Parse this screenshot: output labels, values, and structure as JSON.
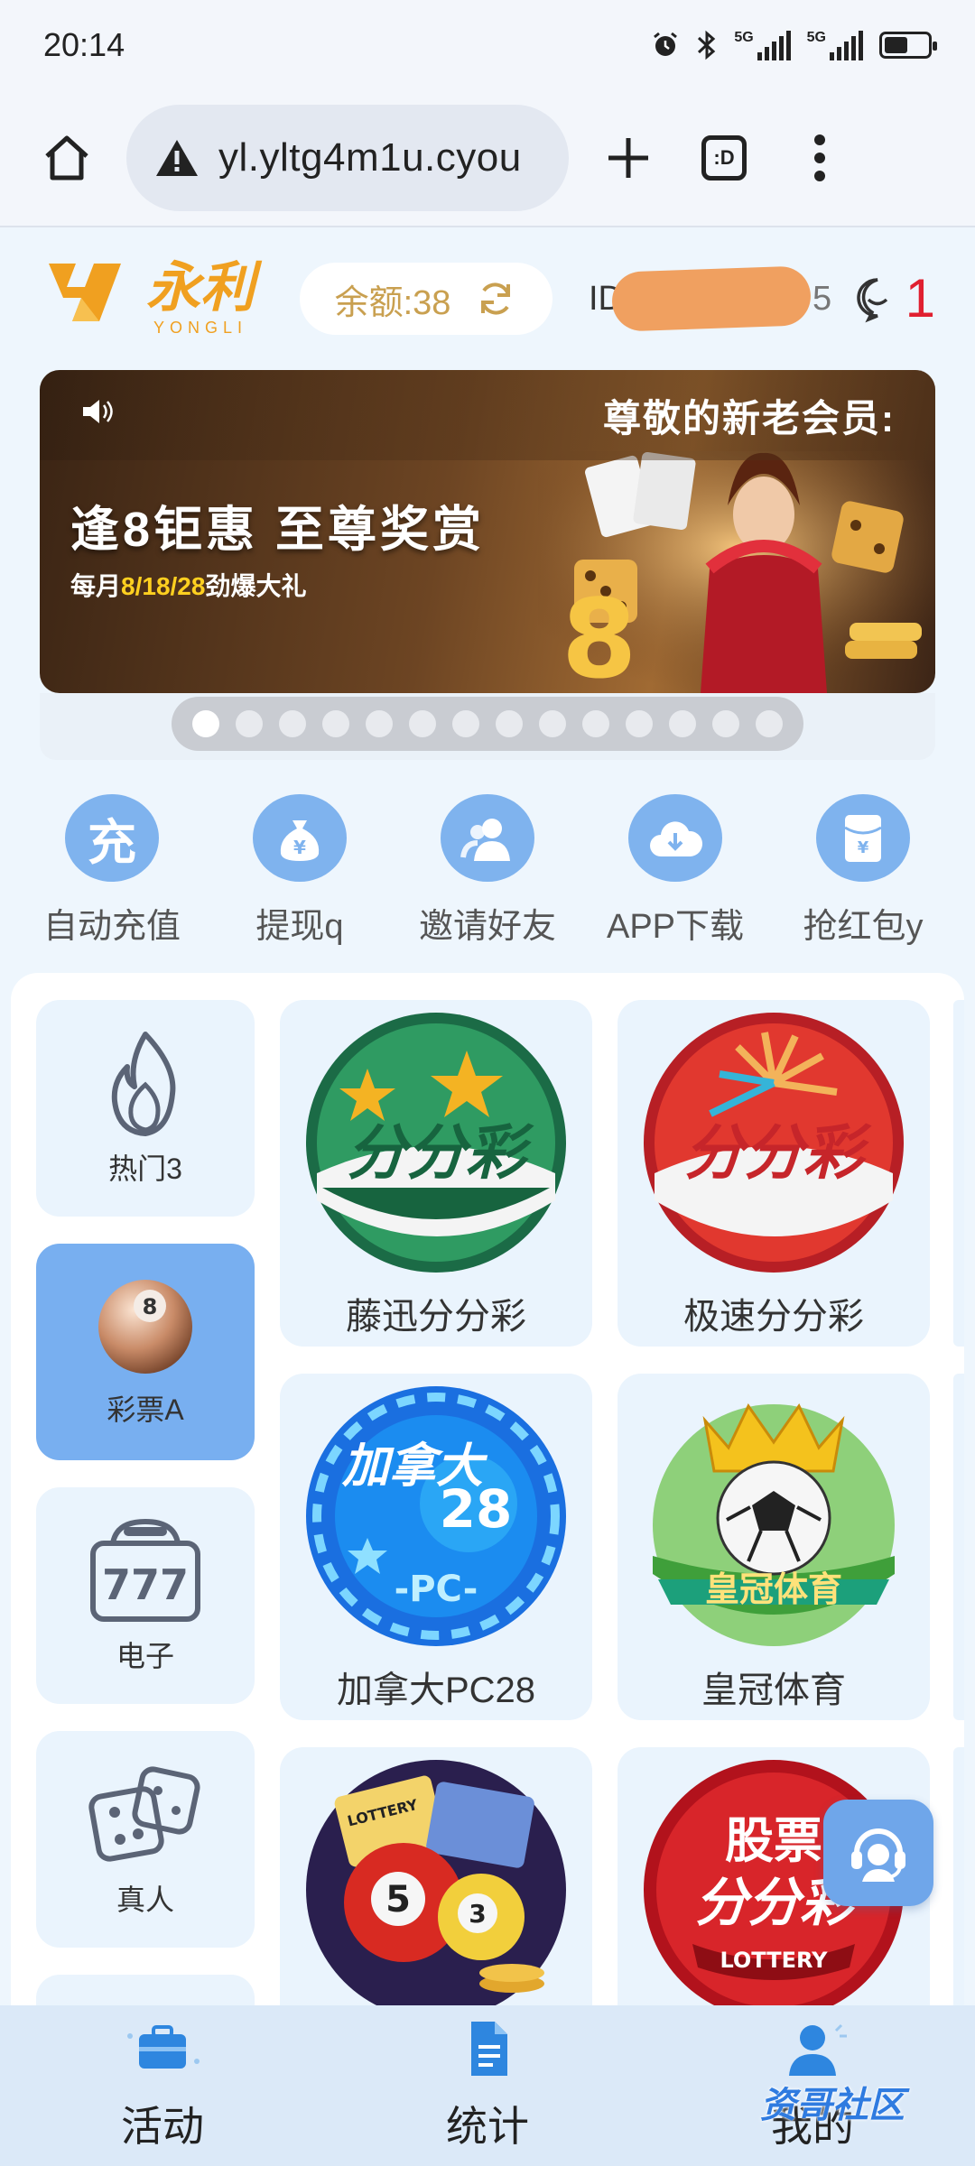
{
  "status_bar": {
    "time": "20:14",
    "net_1": "5G",
    "net_2": "5G"
  },
  "browser": {
    "url": "yl.yltg4m1u.cyou",
    "tabs_label": ":D"
  },
  "header": {
    "logo_cn": "永利",
    "logo_en": "YONGLI",
    "balance": "余额:38",
    "id_label": "ID",
    "id_suffix": "5",
    "message_count": "1"
  },
  "banner": {
    "notice": "尊敬的新老会员:",
    "headline": "逢8钜惠  至尊奖赏",
    "sub_prefix": "每月",
    "sub_highlight": "8/18/28",
    "sub_suffix": "劲爆大礼",
    "slide_count": 14,
    "active_slide": 0
  },
  "quick_actions": [
    {
      "label": "自动充值",
      "glyph": "充",
      "icon": "recharge-icon"
    },
    {
      "label": "提现q",
      "glyph": "",
      "icon": "money-bag-icon"
    },
    {
      "label": "邀请好友",
      "glyph": "",
      "icon": "invite-friends-icon"
    },
    {
      "label": "APP下载",
      "glyph": "",
      "icon": "cloud-download-icon"
    },
    {
      "label": "抢红包y",
      "glyph": "",
      "icon": "red-envelope-icon"
    }
  ],
  "categories": [
    {
      "label": "热门3",
      "icon": "flame-icon"
    },
    {
      "label": "彩票A",
      "icon": "lottery-ball-icon"
    },
    {
      "label": "电子",
      "icon": "slot-777-icon"
    },
    {
      "label": "真人",
      "icon": "dice-icon"
    }
  ],
  "games": [
    {
      "label": "藤迅分分彩",
      "art_text": "分分彩"
    },
    {
      "label": "极速分分彩",
      "art_text": "分分彩"
    },
    {
      "label": "加拿大PC28",
      "art_top": "加拿大",
      "art_num": "28",
      "art_tag": "-PC-"
    },
    {
      "label": "皇冠体育",
      "art_text": "皇冠体育"
    },
    {
      "label": "",
      "art_tag": "LOTTERY"
    },
    {
      "label": "",
      "art_top": "股票",
      "art_text": "分分彩",
      "art_tag": "LOTTERY"
    }
  ],
  "bottom_nav": [
    {
      "label": "活动",
      "icon": "briefcase-icon"
    },
    {
      "label": "统计",
      "icon": "document-icon"
    },
    {
      "label": "我的",
      "icon": "user-icon"
    }
  ],
  "watermark": "资哥社区",
  "colors": {
    "accent": "#78aff0",
    "logo": "#f0a020",
    "badge": "#e02030",
    "panel_bg": "#eef6fd"
  }
}
